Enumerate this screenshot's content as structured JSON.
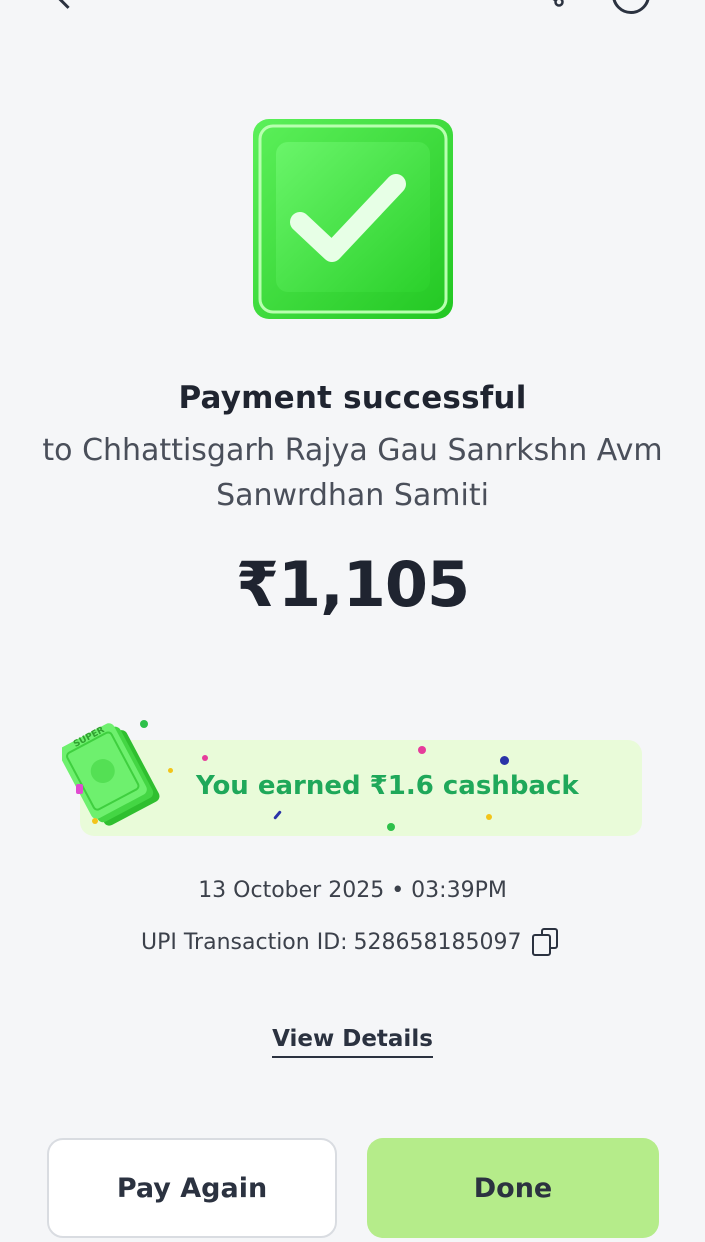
{
  "header": {
    "back_icon": "chevron-left-icon",
    "share_icon": "share-icon",
    "help_icon": "help-icon"
  },
  "status": {
    "icon": "check-icon",
    "title": "Payment successful",
    "payee": "to Chhattisgarh Rajya Gau Sanrkshn Avm Sanwrdhan Samiti",
    "amount": "₹1,105",
    "accent_color": "#3ddc3a"
  },
  "cashback": {
    "text": "You earned ₹1.6 cashback",
    "note_label": "SUPER",
    "text_color": "#1fa85a",
    "background": "#e9fbd9"
  },
  "transaction": {
    "datetime": "13 October 2025 • 03:39PM",
    "upi_label": "UPI Transaction ID:",
    "upi_id": "528658185097",
    "copy_icon": "copy-icon"
  },
  "actions": {
    "view_details": "View Details",
    "pay_again": "Pay Again",
    "done": "Done",
    "done_color": "#b5ec8a"
  }
}
